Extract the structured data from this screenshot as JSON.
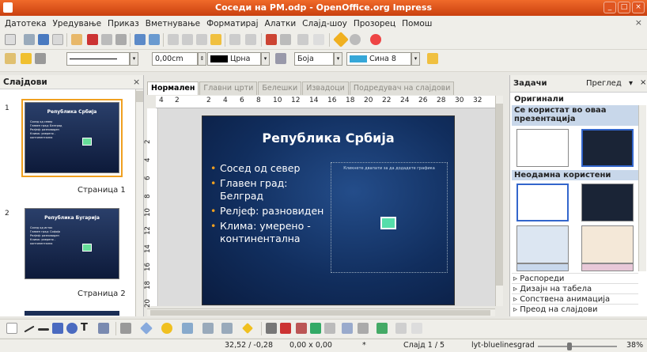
{
  "window": {
    "title": "Соседи на PM.odp - OpenOffice.org Impress"
  },
  "menu": [
    "Датотека",
    "Уредување",
    "Приказ",
    "Вметнување",
    "Форматирај",
    "Алатки",
    "Слајд-шоу",
    "Прозорец",
    "Помош"
  ],
  "line_toolbar": {
    "width_value": "0,00cm",
    "color_value": "Црна",
    "area_mode": "Боја",
    "area_color": "Сина 8"
  },
  "slides_pane": {
    "title": "Слајдови",
    "slides": [
      {
        "number": "1",
        "label": "Страница 1",
        "thumb_title": "Република Србија",
        "thumb_lines": [
          "Сосед од север",
          "Главен град: Белград",
          "Релјеф: разновиден",
          "Клима: умерено - континентална"
        ]
      },
      {
        "number": "2",
        "label": "Страница 2",
        "thumb_title": "Република Бугарија",
        "thumb_lines": [
          "Сосед од исток",
          "Главен град: Софија",
          "Релјеф: разновиден",
          "Клима: умерено - континентална"
        ]
      }
    ]
  },
  "view_tabs": [
    "Нормален",
    "Главни црти",
    "Белешки",
    "Извадоци",
    "Подредувач на слајдови"
  ],
  "ruler": {
    "h_ticks": [
      "4",
      "2",
      "2",
      "4",
      "6",
      "8",
      "10",
      "12",
      "14",
      "16",
      "18",
      "20",
      "22",
      "24",
      "26",
      "28",
      "30",
      "32"
    ],
    "v_ticks": [
      "2",
      "4",
      "6",
      "8",
      "10",
      "12",
      "14",
      "16",
      "18",
      "20"
    ]
  },
  "slide": {
    "title": "Република Србија",
    "bullets": [
      "Сосед од север",
      "Главен град: Белград",
      "Релјеф: разновиден",
      "Клима: умерено - континентална"
    ],
    "placeholder_text": "Кликнете двапати за да додадете графика"
  },
  "task_pane": {
    "title": "Задачи",
    "view_label": "Преглед",
    "section_masters": "Оригинали",
    "used_in": "Се користат во оваа презентација",
    "recent": "Неодамна користени",
    "accordion": [
      "Распореди",
      "Дизајн на табела",
      "Сопствена анимација",
      "Преод на слајдови"
    ]
  },
  "status": {
    "position": "32,52 / -0,28",
    "size": "0,00 x 0,00",
    "slide": "Слајд 1 / 5",
    "master": "lyt-bluelinesgrad",
    "zoom": "38%",
    "zoom_fraction": 0.38
  },
  "colors": {
    "titlebar": "#e05520",
    "slide_bg": "#112e5e",
    "bullet": "#f0a020",
    "selection": "#f0a020"
  }
}
